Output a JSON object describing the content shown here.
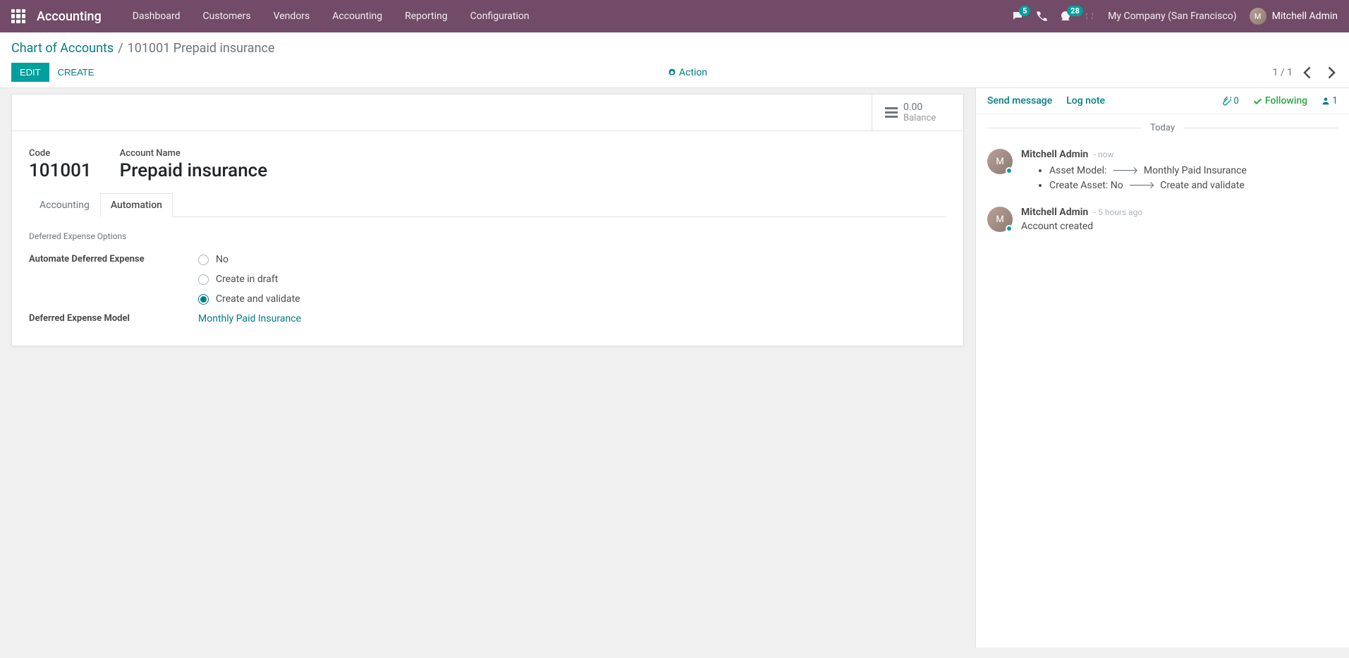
{
  "navbar": {
    "app_name": "Accounting",
    "menu": [
      "Dashboard",
      "Customers",
      "Vendors",
      "Accounting",
      "Reporting",
      "Configuration"
    ],
    "chat_badge": "5",
    "activities_badge": "28",
    "company": "My Company (San Francisco)",
    "user": "Mitchell Admin"
  },
  "breadcrumb": {
    "parent": "Chart of Accounts",
    "current": "101001 Prepaid insurance"
  },
  "control": {
    "edit": "Edit",
    "create": "Create",
    "action": "Action",
    "pager": "1 / 1"
  },
  "stat_button": {
    "value": "0.00",
    "label": "Balance"
  },
  "form": {
    "code_label": "Code",
    "code": "101001",
    "name_label": "Account Name",
    "name": "Prepaid insurance",
    "tabs": {
      "accounting": "Accounting",
      "automation": "Automation"
    },
    "section": "Deferred Expense Options",
    "automate_label": "Automate Deferred Expense",
    "opt_no": "No",
    "opt_draft": "Create in draft",
    "opt_validate": "Create and validate",
    "model_label": "Deferred Expense Model",
    "model_value": "Monthly Paid Insurance"
  },
  "chatter": {
    "send": "Send message",
    "log": "Log note",
    "attach_count": "0",
    "following": "Following",
    "followers": "1",
    "date_sep": "Today",
    "messages": [
      {
        "author": "Mitchell Admin",
        "time": "- now",
        "changes": [
          {
            "field": "Asset Model:",
            "new": "Monthly Paid Insurance"
          },
          {
            "field": "Create Asset:",
            "old": "No",
            "new": "Create and validate"
          }
        ]
      },
      {
        "author": "Mitchell Admin",
        "time": "- 5 hours ago",
        "text": "Account created"
      }
    ]
  }
}
